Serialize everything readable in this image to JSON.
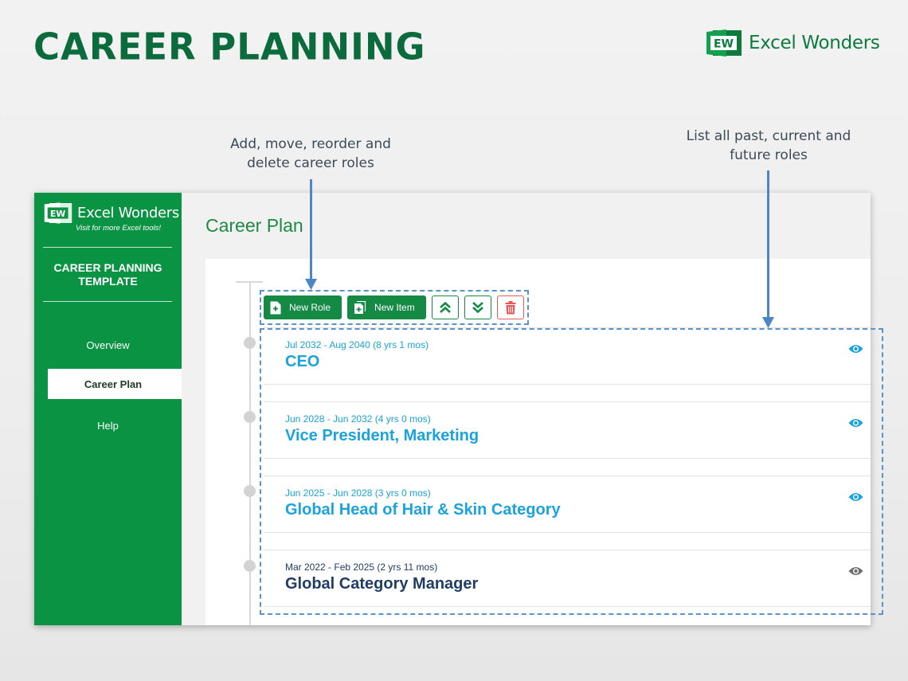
{
  "page_title": "CAREER PLANNING",
  "brand": {
    "logo_text": "EW",
    "name": "Excel Wonders",
    "tagline": "Visit for more Excel tools!"
  },
  "annotations": {
    "left": [
      "Add, move, reorder and",
      "delete career roles"
    ],
    "right": [
      "List all past, current and",
      "future roles"
    ]
  },
  "sidebar": {
    "title": [
      "CAREER PLANNING",
      "TEMPLATE"
    ],
    "nav": [
      {
        "label": "Overview",
        "active": false
      },
      {
        "label": "Career Plan",
        "active": true
      },
      {
        "label": "Help",
        "active": false
      }
    ]
  },
  "main": {
    "heading": "Career Plan",
    "toolbar": {
      "new_role": "New Role",
      "new_item": "New Item",
      "move_up_icon": "double-chevron-up-icon",
      "move_down_icon": "double-chevron-down-icon",
      "delete_icon": "trash-icon"
    },
    "roles": [
      {
        "dates": "Jul 2032 - Aug 2040 (8 yrs 1 mos)",
        "title": "CEO",
        "status": "future"
      },
      {
        "dates": "Jun 2028 - Jun 2032 (4 yrs 0 mos)",
        "title": "Vice President, Marketing",
        "status": "future"
      },
      {
        "dates": "Jun 2025 - Jun 2028 (3 yrs 0 mos)",
        "title": "Global Head of Hair & Skin Category",
        "status": "future"
      },
      {
        "dates": "Mar 2022 - Feb 2025 (2 yrs 11 mos)",
        "title": "Global Category Manager",
        "status": "current"
      }
    ]
  },
  "colors": {
    "title_green": "#0c6b3c",
    "sidebar_green": "#0b9344",
    "button_green": "#148a45",
    "future_role_blue": "#1aa3dd",
    "current_role_navy": "#1f3d66",
    "delete_red": "#e35b5b",
    "annotation_blue": "#4c86c7",
    "eye_gray": "#6e6e6e"
  }
}
